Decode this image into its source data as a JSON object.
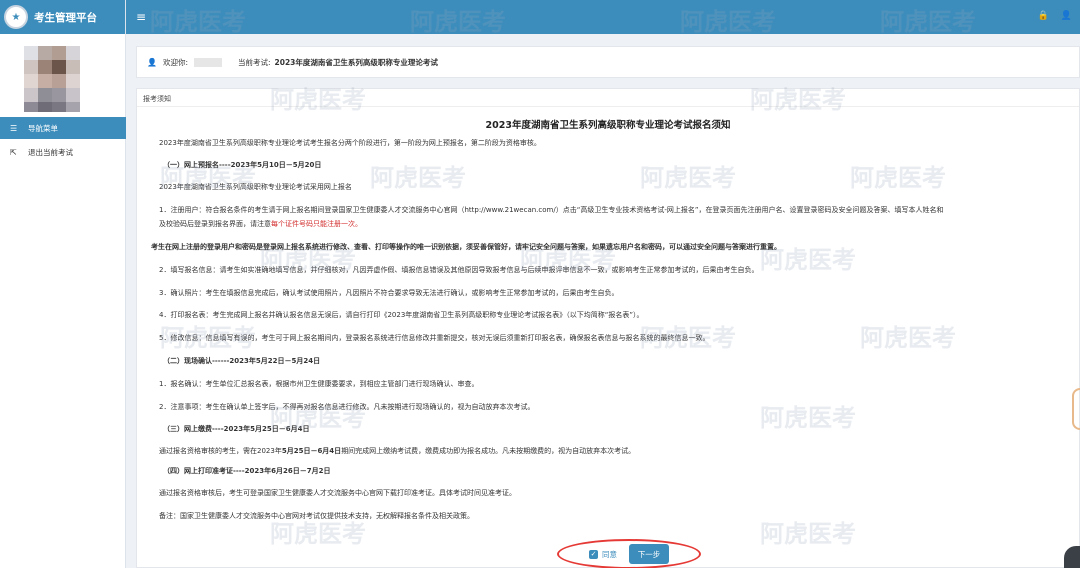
{
  "app": {
    "brand_title": "考生管理平台",
    "logo_icon": "seal-logo"
  },
  "sidebar": {
    "nav_menu_label": "导航菜单",
    "exit_exam_label": "退出当前考试"
  },
  "topbar": {
    "menu_icon": "hamburger-icon",
    "icons": [
      "lock-icon",
      "user-icon"
    ]
  },
  "welcome": {
    "greeting": "欢迎你:",
    "current_exam_label": "当前考试:",
    "current_exam_name": "2023年度湖南省卫生系列高级职称专业理论考试"
  },
  "panel": {
    "header": "报考须知",
    "title": "2023年度湖南省卫生系列高级职称专业理论考试报名须知",
    "lines": {
      "intro": "2023年度湖南省卫生系列高级职称专业理论考试考生报名分两个阶段进行，第一阶段为网上预报名，第二阶段为资格审核。",
      "sec1": "（一）网上预报名----2023年5月10日－5月20日",
      "sec1_desc": "2023年度湖南省卫生系列高级职称专业理论考试采用网上报名",
      "item1a": "1．注册用户：符合报名条件的考生请于网上报名期间登录国家卫生健康委人才交流服务中心官网（http://www.21wecan.com/）点击“高级卫生专业技术资格考试-网上报名”，在登录页面先注册用户名、设置登录密码及安全问题及答案、填写本人姓名和",
      "item1b_pre": "及校验码后登录到报名界面，请注意",
      "item1b_red": "每个证件号码只能注册一次。",
      "bold_line": "考生在网上注册的登录用户和密码是登录网上报名系统进行修改、查看、打印等操作的唯一识别依据，须妥善保管好，请牢记安全问题与答案，如果遗忘用户名和密码，可以通过安全问题与答案进行重置。",
      "item2": "2．填写报名信息：请考生如实准确地填写信息，并仔细核对，凡因弄虚作假、填报信息错误及其他原因导致报考信息与后续申报评审信息不一致，或影响考生正常参加考试的，后果由考生自负。",
      "item3": "3．确认照片：考生在填报信息完成后，确认考试使用照片，凡因照片不符合要求导致无法进行确认，或影响考生正常参加考试的，后果由考生自负。",
      "item4": "4．打印报名表：考生完成网上报名并确认报名信息无误后，请自行打印《2023年度湖南省卫生系列高级职称专业理论考试报名表》（以下均简称“报名表”）。",
      "item5": "5．修改信息：信息填写有误的，考生可于网上报名期间内，登录报名系统进行信息修改并重新提交，核对无误后须重新打印报名表，确保报名表信息与报名系统的最终信息一致。",
      "sec2": "（二）现场确认------2023年5月22日－5月24日",
      "sec2_1": "1．报名确认：考生单位汇总报名表，根据市州卫生健康委要求，到相应主管部门进行现场确认、审查。",
      "sec2_2": "2．注意事项：考生在确认单上签字后，不得再对报名信息进行修改。凡未按期进行现场确认的，视为自动放弃本次考试。",
      "sec3": "（三）网上缴费----2023年5月25日－6月4日",
      "sec3_pre": "通过报名资格审核的考生，需在2023年",
      "sec3_bold": "5月25日－6月4日",
      "sec3_post": "期间完成网上缴纳考试费，缴费成功即为报名成功。凡未按期缴费的，视为自动放弃本次考试。",
      "sec4": "（四）网上打印准考证----2023年6月26日－7月2日",
      "sec4_desc": "通过报名资格审核后，考生可登录国家卫生健康委人才交流服务中心官网下载打印准考证。具体考试时间见准考证。",
      "note": "备注：国家卫生健康委人才交流服务中心官网对考试仅提供技术支持，无权解释报名条件及相关政策。"
    }
  },
  "footer": {
    "agree_label": "同意",
    "next_label": "下一步",
    "agree_checked": true
  },
  "watermark": "阿虎医考",
  "colors": {
    "primary": "#3c8dbc",
    "highlight_red": "#d32f2f",
    "annotation_oval": "#e53935"
  }
}
